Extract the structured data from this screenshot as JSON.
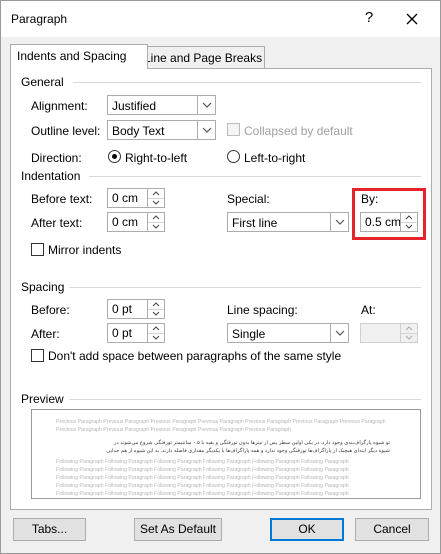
{
  "window": {
    "title": "Paragraph",
    "help": "?"
  },
  "tabs": [
    {
      "label": "Indents and Spacing",
      "active": true
    },
    {
      "label": "Line and Page Breaks",
      "active": false
    }
  ],
  "general": {
    "title": "General",
    "alignment_label": "Alignment:",
    "alignment_value": "Justified",
    "outline_label": "Outline level:",
    "outline_value": "Body Text",
    "collapsed_label": "Collapsed by default",
    "direction_label": "Direction:",
    "rtl_label": "Right-to-left",
    "ltr_label": "Left-to-right",
    "direction_selected": "rtl"
  },
  "indentation": {
    "title": "Indentation",
    "before_label": "Before text:",
    "before_value": "0 cm",
    "after_label": "After text:",
    "after_value": "0 cm",
    "special_label": "Special:",
    "special_value": "First line",
    "by_label": "By:",
    "by_value": "0.5 cm",
    "mirror_label": "Mirror indents"
  },
  "spacing": {
    "title": "Spacing",
    "before_label": "Before:",
    "before_value": "0 pt",
    "after_label": "After:",
    "after_value": "0 pt",
    "line_spacing_label": "Line spacing:",
    "line_spacing_value": "Single",
    "at_label": "At:",
    "at_value": "",
    "dont_add_label": "Don't add space between paragraphs of the same style"
  },
  "preview": {
    "title": "Preview",
    "prev_lines": [
      "Previous Paragraph Previous Paragraph Previous Paragraph Previous Paragraph Previous Paragraph Previous Paragraph Previous Paragraph",
      "Previous Paragraph Previous Paragraph Previous Paragraph Previous Paragraph Previous Paragraph"
    ],
    "sample_lines": [
      "تو شیوه پارگراف‌بندی وجود دارد. در یکی اولین سطر پس از تیترها بدون تورفتگی و بقیه با ۰.۵ سانتیمتر تورفتگی شروع می‌شوند در",
      "شیوه دیگر ابتدای هیچیک از پاراگراف‌ها تورفتگی وجود ندارد و همه پاراگراف‌ها با یکدیگر مقداری فاصله دارند. به این شیوه از هم‌ جدایی"
    ],
    "next_lines": [
      "Following Paragraph Following Paragraph Following Paragraph Following Paragraph Following Paragraph Following Paragraph",
      "Following Paragraph Following Paragraph Following Paragraph Following Paragraph Following Paragraph Following Paragraph",
      "Following Paragraph Following Paragraph Following Paragraph Following Paragraph Following Paragraph Following Paragraph",
      "Following Paragraph Following Paragraph Following Paragraph Following Paragraph Following Paragraph Following Paragraph",
      "Following Paragraph Following Paragraph Following Paragraph Following Paragraph Following Paragraph Following Paragraph"
    ]
  },
  "buttons": {
    "tabs": "Tabs...",
    "set_default": "Set As Default",
    "ok": "OK",
    "cancel": "Cancel"
  },
  "colors": {
    "highlight": "#e5232a",
    "accent": "#0078d7"
  }
}
